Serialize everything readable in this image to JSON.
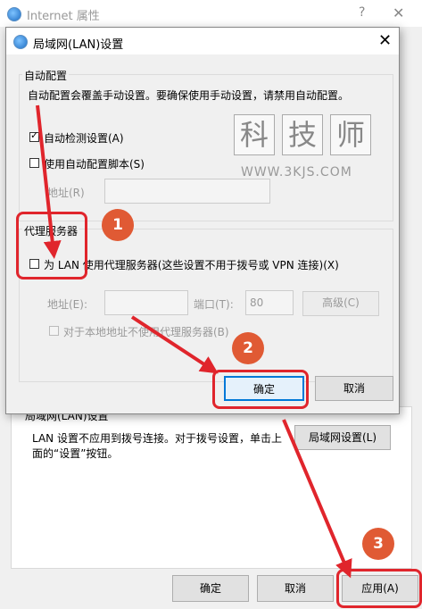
{
  "background_window": {
    "title": "Internet 属性",
    "help": "?",
    "close": "✕",
    "lan_section_label": "局域网(LAN)设置",
    "lan_note": "LAN 设置不应用到拨号连接。对于拨号设置，单击上面的“设置”按钮。",
    "lan_settings_button": "局域网设置(L)",
    "ok_button": "确定",
    "cancel_button": "取消",
    "apply_button": "应用(A)"
  },
  "dialog": {
    "title": "局域网(LAN)设置",
    "close": "✕",
    "auto_config": {
      "legend": "自动配置",
      "description": "自动配置会覆盖手动设置。要确保使用手动设置，请禁用自动配置。",
      "auto_detect_label": "自动检测设置(A)",
      "auto_detect_checked": true,
      "use_script_label": "使用自动配置脚本(S)",
      "use_script_checked": false,
      "address_label": "地址(R)",
      "address_value": ""
    },
    "proxy": {
      "legend": "代理服务器",
      "use_proxy_label": "为 LAN 使用代理服务器(这些设置不用于拨号或 VPN 连接)(X)",
      "use_proxy_checked": false,
      "address_label": "地址(E):",
      "address_value": "",
      "port_label": "端口(T):",
      "port_value": "80",
      "advanced_button": "高级(C)",
      "bypass_label": "对于本地地址不使用代理服务器(B)",
      "bypass_checked": false
    },
    "ok_button": "确定",
    "cancel_button": "取消"
  },
  "watermark": {
    "chars": [
      "科",
      "技",
      "师"
    ],
    "url": "WWW.3KJS.COM"
  },
  "annotations": {
    "step1": "1",
    "step2": "2",
    "step3": "3",
    "color": "#e0252c",
    "badge_color": "#e05a34"
  }
}
